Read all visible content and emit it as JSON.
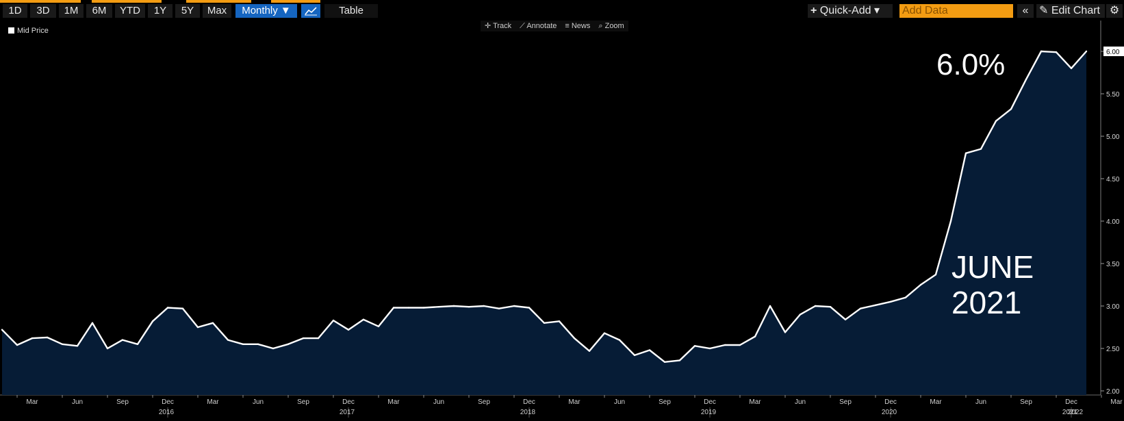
{
  "toolbar": {
    "periods": [
      "1D",
      "3D",
      "1M",
      "6M",
      "YTD",
      "1Y",
      "5Y",
      "Max"
    ],
    "frequency": "Monthly ▼",
    "table_label": "Table",
    "quick_add": "Quick-Add ▾",
    "add_data_placeholder": "Add Data",
    "edit_chart": "Edit Chart",
    "accent_color": "#1565c0",
    "input_color": "#f39c12"
  },
  "tools": [
    "Track",
    "Annotate",
    "News",
    "Zoom"
  ],
  "legend": {
    "label": "Mid Price",
    "color": "#ffffff"
  },
  "annotations": {
    "top": "6.0%",
    "middle_line1": "JUNE",
    "middle_line2": "2021"
  },
  "chart_data": {
    "type": "area",
    "series": [
      {
        "name": "Mid Price",
        "line_color": "#ffffff",
        "fill_color": "#061c36"
      }
    ],
    "values": [
      2.72,
      2.54,
      2.62,
      2.63,
      2.55,
      2.53,
      2.8,
      2.5,
      2.6,
      2.55,
      2.82,
      2.98,
      2.97,
      2.75,
      2.8,
      2.6,
      2.55,
      2.55,
      2.5,
      2.55,
      2.62,
      2.62,
      2.83,
      2.72,
      2.84,
      2.76,
      2.98,
      2.98,
      2.98,
      2.99,
      3.0,
      2.99,
      3.0,
      2.97,
      3.0,
      2.98,
      2.8,
      2.82,
      2.62,
      2.47,
      2.68,
      2.6,
      2.42,
      2.48,
      2.34,
      2.36,
      2.53,
      2.5,
      2.54,
      2.54,
      2.64,
      3.0,
      2.69,
      2.9,
      3.0,
      2.99,
      2.84,
      2.97,
      3.01,
      3.05,
      3.1,
      3.25,
      3.37,
      4.0,
      4.8,
      4.85,
      5.18,
      5.32,
      5.67,
      6.0,
      5.99,
      5.8,
      6.0
    ],
    "start": "2016-02",
    "frequency": "monthly",
    "month_ticks": [
      "Mar",
      "Jun",
      "Sep",
      "Dec",
      "Mar",
      "Jun",
      "Sep",
      "Dec",
      "Mar",
      "Jun",
      "Sep",
      "Dec",
      "Mar",
      "Jun",
      "Sep",
      "Dec",
      "Mar",
      "Jun",
      "Sep",
      "Dec",
      "Mar",
      "Jun",
      "Sep",
      "Dec",
      "Mar"
    ],
    "year_labels": [
      "2016",
      "2017",
      "2018",
      "2019",
      "2020",
      "2021",
      "2022"
    ],
    "yticks": [
      "2.00",
      "2.50",
      "3.00",
      "3.50",
      "4.00",
      "4.50",
      "5.00",
      "5.50",
      "6.00"
    ],
    "ylim": [
      2.0,
      6.2
    ],
    "last_value_label": "6.00",
    "grid": false,
    "legend_position": "top-left"
  }
}
